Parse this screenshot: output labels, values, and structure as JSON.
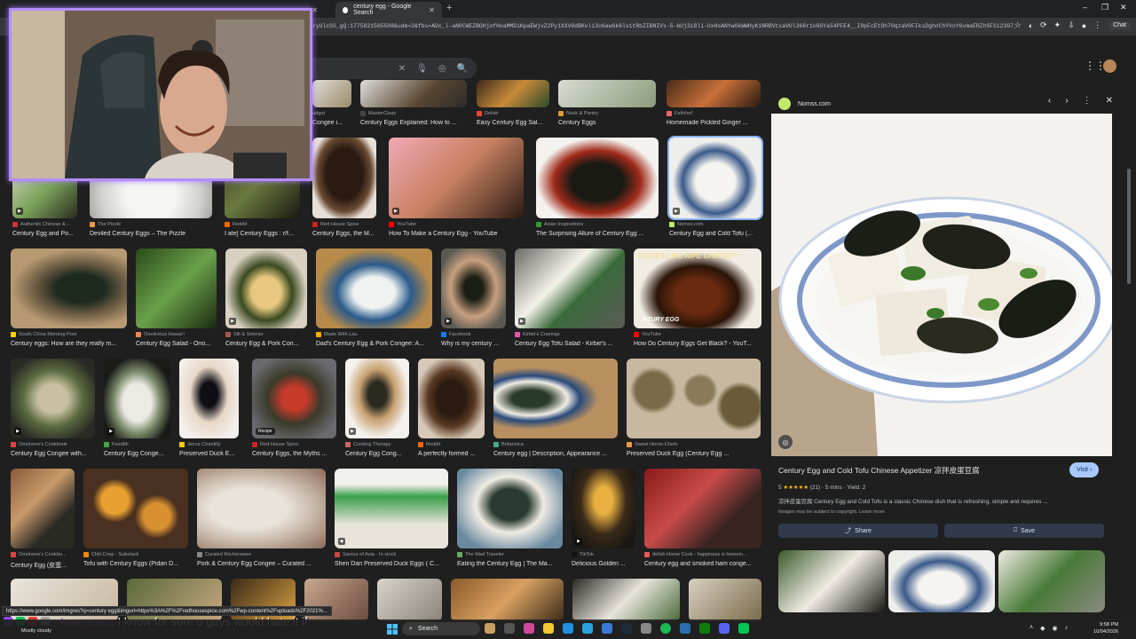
{
  "browser": {
    "tabs": [
      {
        "title": "",
        "active": false
      },
      {
        "title": "century egg - Google Search",
        "active": true
      }
    ],
    "url": "ryUlcSS_gQ:1775821505508&udm=2&fbs=ADc_l-aN0CWEZBOHjofHoaMMDiKpaEWjvZ2Py1XXV8dBKvli3o6awGk6lv1tRbZIBNIVs-5-bUj3i8li-UxHsANYwOkWWHyK1NRBVtxaVUl368r1o6GYaS4PFE4__I9pFcEtDh70qzaV0FIksDghnChYVoYGvmaERZhSFSi23G7_I_x...",
    "new_tab_symbol": "+",
    "chat_label": "Chat"
  },
  "google": {
    "search_query": "century egg"
  },
  "results": [
    {
      "source": "udget",
      "title": "Congee i..."
    },
    {
      "source": "MasterClass",
      "title": "Century Eggs Explained: How to ..."
    },
    {
      "source": "Delish",
      "title": "Easy Century Egg Sal..."
    },
    {
      "source": "Nook & Pantry",
      "title": "Century Eggs"
    },
    {
      "source": "Feltchef",
      "title": "Homemade Pickled Ginger ..."
    },
    {
      "source": "Authentic Chinese & ...",
      "title": "Century Egg and Po..."
    },
    {
      "source": "The Pizzle",
      "title": "Deviled Century Eggs – The Pizzle"
    },
    {
      "source": "Reddit",
      "title": "I ate] Century Eggs : r/f..."
    },
    {
      "source": "Red House Spice",
      "title": "Century Eggs, the M..."
    },
    {
      "source": "YouTube",
      "title": "How To Make a Century Egg - YouTube"
    },
    {
      "source": "Asian Inspirations",
      "title": "The Surprising Allure of Century Egg ..."
    },
    {
      "source": "Nomss.com",
      "title": "Century Egg and Cold Tofu (..."
    },
    {
      "source": "South China Morning Post",
      "title": "Century eggs: How are they really m..."
    },
    {
      "source": "Onolicious Hawaiʻi",
      "title": "Century Egg Salad - Ono..."
    },
    {
      "source": "Silt & Simmer",
      "title": "Century Egg & Pork Con..."
    },
    {
      "source": "Made With Lau",
      "title": "Dad's Century Egg & Pork Congee: A..."
    },
    {
      "source": "Facebook",
      "title": "Why is my century ..."
    },
    {
      "source": "Kirbie's Cravings",
      "title": "Century Egg Tofu Salad - Kirbie's ..."
    },
    {
      "source": "YouTube",
      "title": "How Do Century Eggs Get Black? - YouT..."
    },
    {
      "source": "Omnivore's Cookbook",
      "title": "Century Egg Congee with..."
    },
    {
      "source": "FeedMi",
      "title": "Century Egg Conge..."
    },
    {
      "source": "Jecca Chantilly",
      "title": "Preserved Duck E..."
    },
    {
      "source": "Red House Spice",
      "title": "Century Eggs, the Myths ..."
    },
    {
      "source": "Cooking Therapy",
      "title": "Century Egg Cong..."
    },
    {
      "source": "Reddit",
      "title": "A perfectly formed ..."
    },
    {
      "source": "Britannica",
      "title": "Century egg | Description, Appearance ..."
    },
    {
      "source": "Sweet Home-Chefs",
      "title": "Preserved Duck Egg (Century Egg ..."
    },
    {
      "source": "Omnivore's Cookbo...",
      "title": "Century Egg (皮蛋..."
    },
    {
      "source": "Chili Crisp - Substack",
      "title": "Tofu with Century Eggs (Pidan D..."
    },
    {
      "source": "Curated Kitchenware",
      "title": "Pork & Century Egg Congee – Curated ..."
    },
    {
      "source": "Savour of Asia · In stock",
      "title": "Shen Dan Preserved Duck Eggs ( C..."
    },
    {
      "source": "The Mad Traveler",
      "title": "Eating the Century Egg | The Ma..."
    },
    {
      "source": "TikTok",
      "title": "Delicious Golden ..."
    },
    {
      "source": "delish Home Cook - happiness is homem...",
      "title": "Century egg and smoked ham conge..."
    }
  ],
  "badges": {
    "recipe": "Recipe",
    "thumb_text": "TASTES LIKE RIPE CHEESE?",
    "thumb_text2": "NTURY EGG"
  },
  "panel": {
    "site": "Nomss.com",
    "title": "Century Egg and Cold Tofu Chinese Appetizer 凉拌皮蛋豆腐",
    "visit_label": "Visit",
    "rating_value": "5",
    "stars": "★★★★★",
    "rating_count": "(21)",
    "time": "5 mins",
    "yield": "Yield: 2",
    "description": "凉拌皮蛋豆腐 Century Egg and Cold Tofu is a classic Chinese dish that is refreshing, simple and requires ...",
    "copyright_note": "Images may be subject to copyright.",
    "learn_more": "Learn more",
    "share_label": "Share",
    "save_label": "Save"
  },
  "status_url": "https://www.google.com/imgres?q=century egg&imgurl=https%3A%2F%2Fredhousespice.com%2Fwp-content%2Fuploads%2F2021%...",
  "chat": {
    "user": "tunayomz",
    "message": "I know for sure u guys would hate it if"
  },
  "taskbar": {
    "weather": "Mostly cloudy",
    "search_label": "Search",
    "time": "9:58 PM",
    "date": "10/04/2026"
  },
  "colors": {
    "accent": "#8ab4f8",
    "webcam_border": "#b48cff",
    "visit_button": "#a8c7fa",
    "chat_user": "#8d4dc7"
  }
}
